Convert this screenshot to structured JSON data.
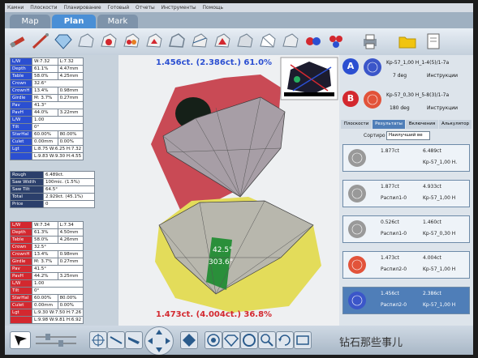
{
  "menu": [
    "Камни",
    "Плоскости",
    "Планирование",
    "Готовый",
    "Отчеты",
    "Инструменты",
    "Помощь"
  ],
  "tabs": [
    {
      "label": "Map"
    },
    {
      "label": "Plan"
    },
    {
      "label": "Mark"
    }
  ],
  "viewport": {
    "top_caption": "1.456ct. (2.386ct.) 61.0%",
    "bottom_caption": "1.473ct. (4.004ct.) 36.8%",
    "facet_label_1": "42.5°",
    "facet_label_2": "303.6°"
  },
  "param_table_1": [
    {
      "label": "L/W",
      "v1": "W:7.32",
      "v2": "L:7.32",
      "color": "#2b4fd1"
    },
    {
      "label": "Depth",
      "v1": "61.1%",
      "v2": "4.47mm",
      "color": "#2b4fd1"
    },
    {
      "label": "Table",
      "v1": "58.0%",
      "v2": "4.25mm",
      "color": "#2b4fd1"
    },
    {
      "label": "Crown",
      "v1": "32.6°",
      "v2": "",
      "color": "#2b4fd1"
    },
    {
      "label": "CrownH",
      "v1": "13.4%",
      "v2": "0.98mm",
      "color": "#2b4fd1"
    },
    {
      "label": "Girdle",
      "v1": "M: 3.7%",
      "v2": "0.27mm",
      "color": "#2b4fd1"
    },
    {
      "label": "Pav",
      "v1": "41.3°",
      "v2": "",
      "color": "#2b4fd1"
    },
    {
      "label": "PavH",
      "v1": "44.0%",
      "v2": "3.22mm",
      "color": "#2b4fd1"
    },
    {
      "label": "L/W",
      "v1": "1.00",
      "v2": "",
      "color": "#2b4fd1"
    },
    {
      "label": "Tilt",
      "v1": "0°",
      "v2": "",
      "color": "#2b4fd1"
    },
    {
      "label": "StarHal",
      "v1": "60.00%",
      "v2": "80.00%",
      "color": "#2b4fd1"
    },
    {
      "label": "Culet",
      "v1": "0.00mm",
      "v2": "0.00%",
      "color": "#2b4fd1"
    },
    {
      "label": "Lgt",
      "v1": "L:8.75 W:6.25 H:7.32",
      "v2": "",
      "color": "#2b4fd1"
    },
    {
      "label": "",
      "v1": "L:9.83 W:9.30 H:4.55",
      "v2": "",
      "color": "#2b4fd1"
    }
  ],
  "rough_table": [
    {
      "label": "Rough",
      "value": "6.489ct."
    },
    {
      "label": "Saw Width",
      "value": "100mic. (1.5%)"
    },
    {
      "label": "Saw Tilt",
      "value": "64.5°"
    },
    {
      "label": "Total",
      "value": "2.929ct. (45.1%)"
    },
    {
      "label": "Price",
      "value": "0"
    }
  ],
  "param_table_2": [
    {
      "label": "L/W",
      "v1": "W:7.34",
      "v2": "L:7.34",
      "color": "#d3282f"
    },
    {
      "label": "Depth",
      "v1": "61.3%",
      "v2": "4.50mm",
      "color": "#d3282f"
    },
    {
      "label": "Table",
      "v1": "58.0%",
      "v2": "4.26mm",
      "color": "#d3282f"
    },
    {
      "label": "Crown",
      "v1": "32.5°",
      "v2": "",
      "color": "#d3282f"
    },
    {
      "label": "CrownH",
      "v1": "13.4%",
      "v2": "0.98mm",
      "color": "#d3282f"
    },
    {
      "label": "Girdle",
      "v1": "M: 3.7%",
      "v2": "0.27mm",
      "color": "#d3282f"
    },
    {
      "label": "Pav",
      "v1": "41.5°",
      "v2": "",
      "color": "#d3282f"
    },
    {
      "label": "PavH",
      "v1": "44.2%",
      "v2": "3.25mm",
      "color": "#d3282f"
    },
    {
      "label": "L/W",
      "v1": "1.00",
      "v2": "",
      "color": "#d3282f"
    },
    {
      "label": "Tilt",
      "v1": "0°",
      "v2": "",
      "color": "#d3282f"
    },
    {
      "label": "StarHal",
      "v1": "60.00%",
      "v2": "80.00%",
      "color": "#d3282f"
    },
    {
      "label": "Culet",
      "v1": "0.00mm",
      "v2": "0.00%",
      "color": "#d3282f"
    },
    {
      "label": "Lgt",
      "v1": "L:9.30 W:7.50 H:7.26",
      "v2": "",
      "color": "#d3282f"
    },
    {
      "label": "",
      "v1": "L:9.98 W:9.81 H:6.92",
      "v2": "",
      "color": "#d3282f"
    }
  ],
  "plan_a": {
    "letter": "A",
    "line1": "Kp-57_1,00 H_1-4(5)/1-7a",
    "deg": "7 deg",
    "instr": "Инструкции"
  },
  "plan_b": {
    "letter": "B",
    "line1": "Kp-57_0,30 H_5-8(3)/1-7a",
    "deg": "180 deg",
    "instr": "Инструкции"
  },
  "right_tabs": [
    "Плоскости",
    "Результаты",
    "Включения",
    "Алькулятор"
  ],
  "sort": {
    "label": "Сортиро",
    "value": "Наилучший ве"
  },
  "results": [
    {
      "c1": "1.877ct",
      "c2": "",
      "c3": "6.489ct",
      "c4": "Kp-57_1,00 H.",
      "color": "#999999",
      "sel": false
    },
    {
      "c1": "1.877ct",
      "c2": "Распил1-0",
      "c3": "4.933ct",
      "c4": "Kp-57_1,00 H",
      "color": "#999999",
      "sel": false
    },
    {
      "c1": "0.526ct",
      "c2": "Распил1-0",
      "c3": "1.460ct",
      "c4": "Kp-57_0,30 H",
      "color": "#999999",
      "sel": false
    },
    {
      "c1": "1.473ct",
      "c2": "Распил2-0",
      "c3": "4.004ct",
      "c4": "Kp-57_1,00 H",
      "color": "#e2533a",
      "sel": false
    },
    {
      "c1": "1.456ct",
      "c2": "Распил2-0",
      "c3": "2.386ct",
      "c4": "Kp-57_1,00 H",
      "color": "#3b56c9",
      "sel": true
    }
  ],
  "watermark": "钻石那些事儿",
  "colors": {
    "blue": "#2b4fd1",
    "red": "#d3282f",
    "sel": "#4f7eb8"
  }
}
